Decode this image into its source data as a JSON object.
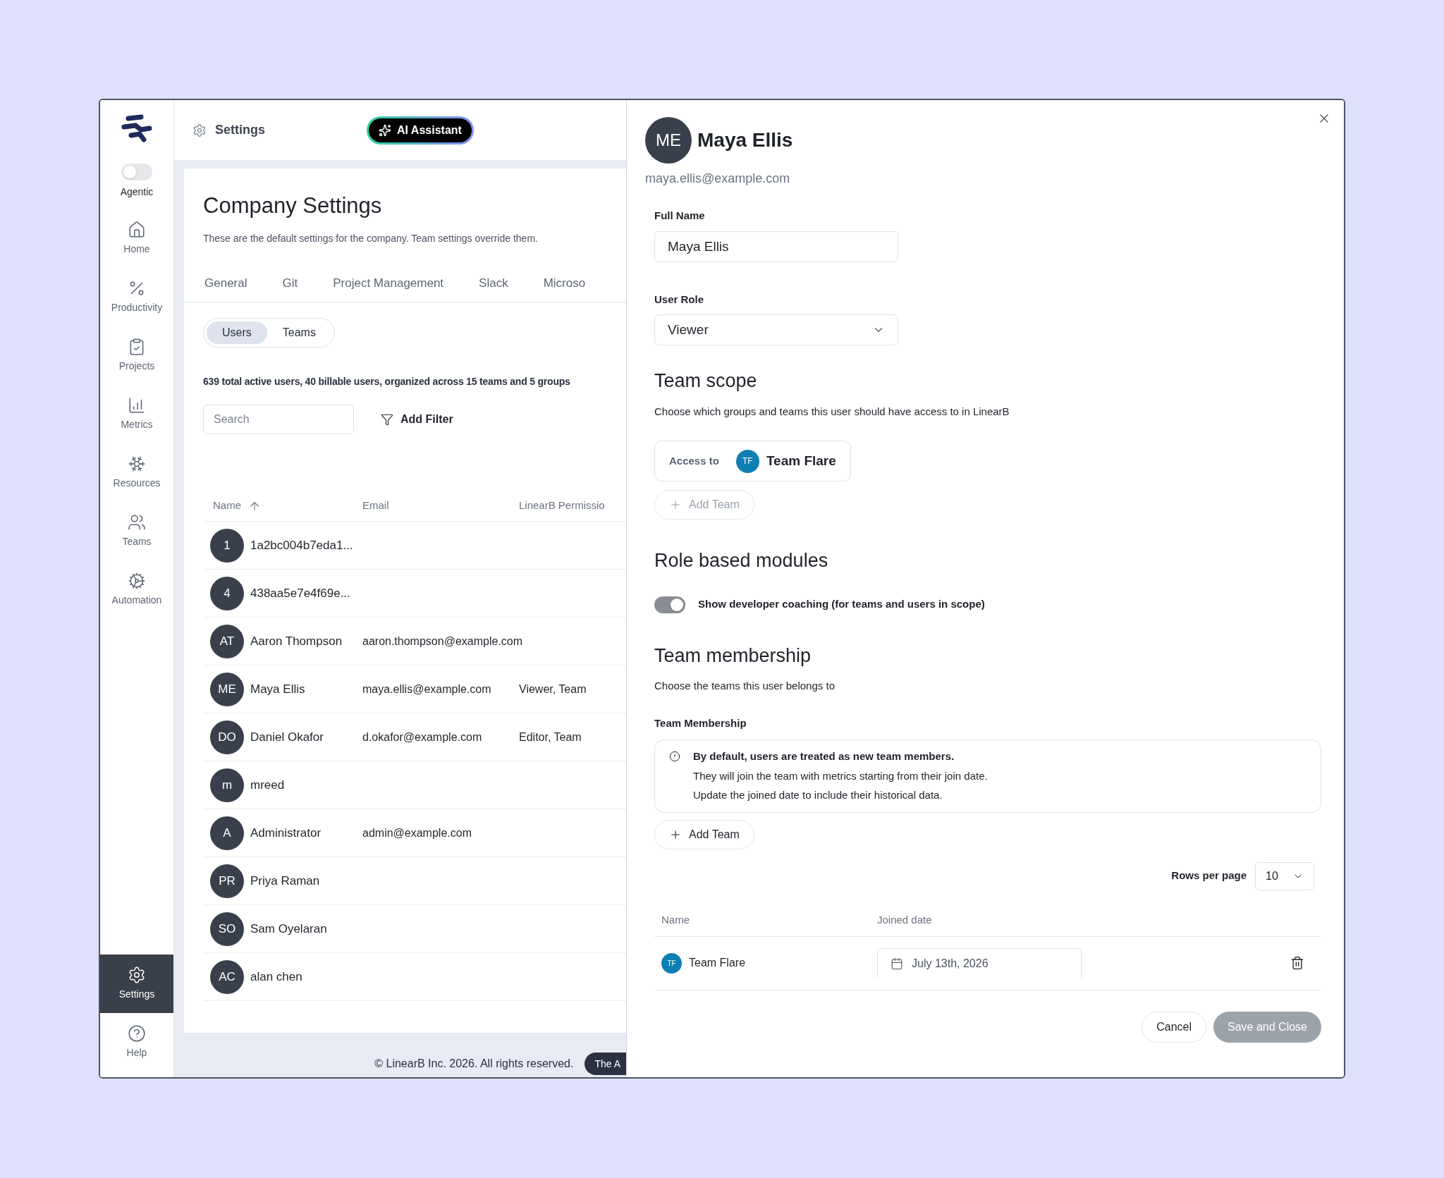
{
  "sidebar": {
    "agentic": {
      "label": "Agentic",
      "on": false
    },
    "items": [
      {
        "label": "Home",
        "selected": false
      },
      {
        "label": "Productivity",
        "selected": false
      },
      {
        "label": "Projects",
        "selected": false
      },
      {
        "label": "Metrics",
        "selected": false
      },
      {
        "label": "Resources",
        "selected": false
      },
      {
        "label": "Teams",
        "selected": false
      },
      {
        "label": "Automation",
        "selected": false
      }
    ],
    "bottom_items": [
      {
        "label": "Settings",
        "selected": true
      },
      {
        "label": "Help",
        "selected": false
      }
    ]
  },
  "header": {
    "title": "Settings",
    "ai_button": "AI Assistant"
  },
  "page": {
    "title": "Company Settings",
    "subtitle": "These are the default settings for the company. Team settings override them.",
    "tabs": [
      {
        "label": "General",
        "selected": false
      },
      {
        "label": "Git",
        "selected": false
      },
      {
        "label": "Project Management",
        "selected": false
      },
      {
        "label": "Slack",
        "selected": false
      },
      {
        "label": "Microso",
        "selected": false
      }
    ],
    "segments": [
      {
        "label": "Users",
        "selected": true
      },
      {
        "label": "Teams",
        "selected": false
      }
    ],
    "summary": "639 total active users, 40 billable users, organized across 15 teams and 5 groups",
    "search": {
      "placeholder": "Search"
    },
    "filter_button": "Add Filter",
    "table": {
      "columns": [
        "Name",
        "Email",
        "LinearB Permissio"
      ],
      "rows": [
        {
          "initials": "1",
          "name": "1a2bc004b7eda1...",
          "email": "",
          "permissions": ""
        },
        {
          "initials": "4",
          "name": "438aa5e7e4f69e...",
          "email": "",
          "permissions": ""
        },
        {
          "initials": "AT",
          "name": "Aaron Thompson",
          "email": "aaron.thompson@example.com",
          "permissions": ""
        },
        {
          "initials": "ME",
          "name": "Maya Ellis",
          "email": "maya.ellis@example.com",
          "permissions": "Viewer, Team"
        },
        {
          "initials": "DO",
          "name": "Daniel Okafor",
          "email": "d.okafor@example.com",
          "permissions": "Editor, Team"
        },
        {
          "initials": "m",
          "name": "mreed",
          "email": "",
          "permissions": ""
        },
        {
          "initials": "A",
          "name": "Administrator",
          "email": "admin@example.com",
          "permissions": ""
        },
        {
          "initials": "PR",
          "name": "Priya Raman",
          "email": "",
          "permissions": ""
        },
        {
          "initials": "SO",
          "name": "Sam Oyelaran",
          "email": "",
          "permissions": ""
        },
        {
          "initials": "AC",
          "name": "alan chen",
          "email": "",
          "permissions": ""
        }
      ]
    },
    "footer": {
      "copyright": "© LinearB Inc. 2026. All rights reserved.",
      "badge": "The A"
    }
  },
  "panel": {
    "initials": "ME",
    "name": "Maya Ellis",
    "email": "maya.ellis@example.com",
    "full_name": {
      "label": "Full Name",
      "value": "Maya Ellis"
    },
    "user_role": {
      "label": "User Role",
      "value": "Viewer"
    },
    "team_scope": {
      "title": "Team scope",
      "description": "Choose which groups and teams this user should have access to in LinearB",
      "access_label": "Access to",
      "team": {
        "initials": "TF",
        "name": "Team Flare"
      },
      "add_button": {
        "label": "Add Team",
        "disabled": true
      }
    },
    "role_modules": {
      "title": "Role based modules",
      "toggle": {
        "label": "Show developer coaching (for teams and users in scope)",
        "on": true,
        "disabled": true
      }
    },
    "membership": {
      "title": "Team membership",
      "description": "Choose the teams this user belongs to",
      "label": "Team Membership",
      "notice": {
        "title": "By default, users are treated as new team members.",
        "lines": [
          "They will join the team with metrics starting from their join date.",
          "Update the joined date to include their historical data."
        ]
      },
      "add_button": {
        "label": "Add Team",
        "disabled": false
      },
      "rows_per_page": {
        "label": "Rows per page",
        "value": "10"
      },
      "table": {
        "columns": [
          "Name",
          "Joined date"
        ],
        "rows": [
          {
            "initials": "TF",
            "name": "Team Flare",
            "joined": "July 13th, 2026"
          }
        ]
      }
    },
    "buttons": [
      {
        "label": "Cancel",
        "kind": "secondary",
        "disabled": false
      },
      {
        "label": "Save and Close",
        "kind": "primary",
        "disabled": true
      }
    ]
  }
}
